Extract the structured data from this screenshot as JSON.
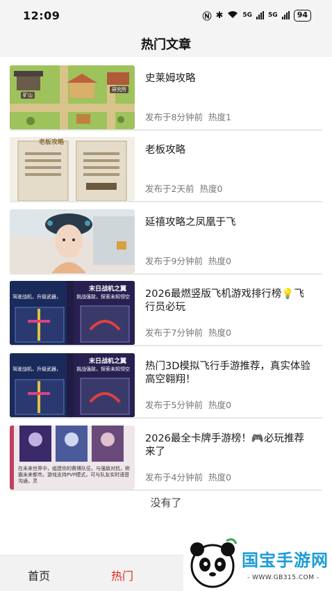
{
  "status_bar": {
    "time": "12:09",
    "signal_1": "5G",
    "signal_2": "5G",
    "battery": "94"
  },
  "header": {
    "title": "热门文章"
  },
  "articles": [
    {
      "title": "史莱姆攻略",
      "published": "发布于8分钟前",
      "heat": "热度1",
      "thumb_text": [
        "矿山",
        "研究所"
      ]
    },
    {
      "title": "老板攻略",
      "published": "发布于2天前",
      "heat": "热度0",
      "thumb_text": [
        "老板攻略"
      ]
    },
    {
      "title": "延禧攻略之凤凰于飞",
      "published": "发布于9分钟前",
      "heat": "热度0",
      "thumb_text": []
    },
    {
      "title": "2026最燃竖版飞机游戏排行榜💡飞行员必玩",
      "published": "发布于7分钟前",
      "heat": "热度0",
      "thumb_text": [
        "驾驶战机，升级武器，",
        "末日战机之翼",
        "挑战强敌，探索未知领空"
      ]
    },
    {
      "title": "热门3D模拟飞行手游推荐，真实体验高空翱翔！",
      "published": "发布于5分钟前",
      "heat": "热度0",
      "thumb_text": [
        "驾驶战机，升级武器，",
        "末日战机之翼",
        "挑战强敌，探索未知领空"
      ]
    },
    {
      "title": "2026最全卡牌手游榜！🎮必玩推荐来了",
      "published": "发布于4分钟前",
      "heat": "热度0",
      "thumb_text": [
        "在未来世界中，组建你的赛博队伍，与强敌对抗，称霸未来都市。游戏支持PVP模式，可与队友实时语音沟通，灵"
      ]
    }
  ],
  "footer_text": "没有了",
  "tabbar": {
    "home": "首页",
    "hot": "热门"
  },
  "watermark": {
    "brand": "国宝手游网",
    "url": "- WWW.GB315.COM -"
  }
}
